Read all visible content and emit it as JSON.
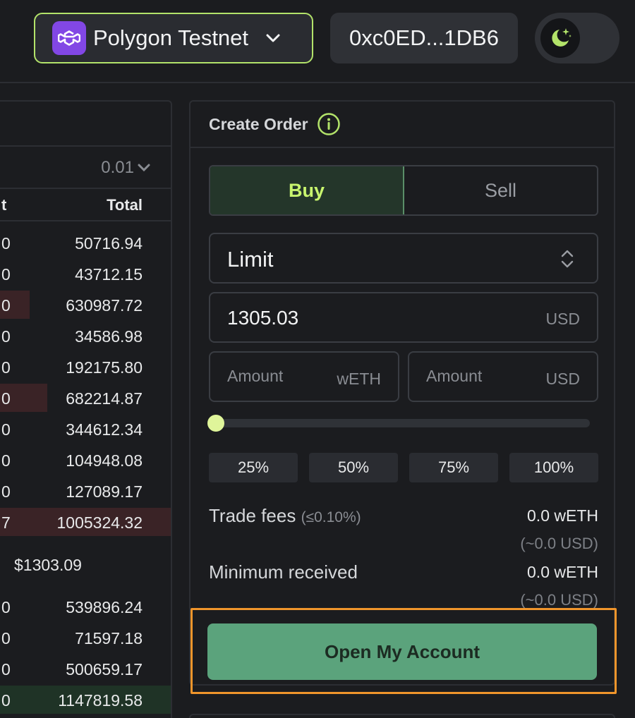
{
  "header": {
    "network": {
      "label": "Polygon Testnet",
      "icon": "polygon-logo-icon",
      "icon_color": "#8247e5",
      "border_color": "#b3e36a"
    },
    "wallet": {
      "address": "0xc0ED...1DB6"
    },
    "theme_toggle": {
      "icon": "moon-stars-icon",
      "mode": "dark"
    }
  },
  "orderbook": {
    "precision": "0.01",
    "columns": {
      "left_partial": "t",
      "total": "Total"
    },
    "asks": [
      {
        "left": "0",
        "total": "50716.94",
        "depth": 0
      },
      {
        "left": "0",
        "total": "43712.15",
        "depth": 0
      },
      {
        "left": "0",
        "total": "630987.72",
        "depth": 0.2
      },
      {
        "left": "0",
        "total": "34586.98",
        "depth": 0
      },
      {
        "left": "0",
        "total": "192175.80",
        "depth": 0
      },
      {
        "left": "0",
        "total": "682214.87",
        "depth": 0.3
      },
      {
        "left": "0",
        "total": "344612.34",
        "depth": 0
      },
      {
        "left": "0",
        "total": "104948.08",
        "depth": 0
      },
      {
        "left": "0",
        "total": "127089.17",
        "depth": 0
      },
      {
        "left": "7",
        "total": "1005324.32",
        "depth": 1
      }
    ],
    "mid_price": "$1303.09",
    "bids": [
      {
        "left": "0",
        "total": "539896.24",
        "depth": 0
      },
      {
        "left": "0",
        "total": "71597.18",
        "depth": 0
      },
      {
        "left": "0",
        "total": "500659.17",
        "depth": 0
      },
      {
        "left": "0",
        "total": "1147819.58",
        "depth": 1
      }
    ],
    "ask_color": "#3a2326",
    "bid_color": "#1f3326"
  },
  "create_order": {
    "title": "Create Order",
    "info_icon": "info-circle-icon",
    "tabs": {
      "buy": "Buy",
      "sell": "Sell",
      "active": "buy"
    },
    "order_type": "Limit",
    "price": {
      "value": "1305.03",
      "unit": "USD"
    },
    "amount_base": {
      "placeholder": "Amount",
      "unit": "wETH"
    },
    "amount_quote": {
      "placeholder": "Amount",
      "unit": "USD"
    },
    "slider_value": 0,
    "percent_buttons": [
      "25%",
      "50%",
      "75%",
      "100%"
    ],
    "trade_fees": {
      "label": "Trade fees",
      "sub": "(≤0.10%)",
      "value": "0.0 wETH",
      "usd": "(~0.0 USD)"
    },
    "min_received": {
      "label": "Minimum received",
      "value": "0.0 wETH",
      "usd": "(~0.0 USD)"
    },
    "cta": "Open My Account"
  }
}
